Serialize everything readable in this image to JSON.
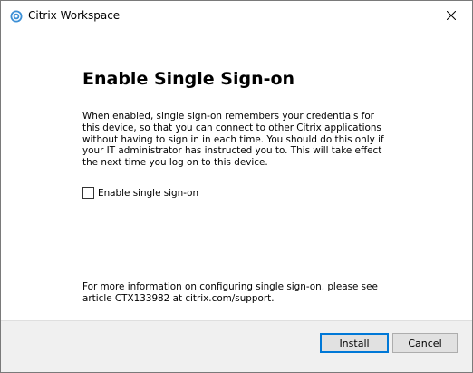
{
  "window": {
    "title": "Citrix Workspace"
  },
  "dialog": {
    "heading": "Enable Single Sign-on",
    "description": "When enabled, single sign-on remembers your credentials for this device, so that you can connect to other Citrix applications without having to sign in in each time. You should do this only if your IT administrator has instructed you to. This will take effect the next time you log on to this device.",
    "checkbox": {
      "label": "Enable single sign-on",
      "checked": false
    },
    "more_info": "For more information on configuring single sign-on, please see article CTX133982 at citrix.com/support."
  },
  "buttons": {
    "install_label": "Install",
    "cancel_label": "Cancel"
  },
  "colors": {
    "accent": "#0078d7",
    "footer_bg": "#f0f0f0",
    "app_icon": "#3b8fd6"
  },
  "icons": {
    "app": "citrix-logo-icon",
    "close": "close-icon"
  }
}
